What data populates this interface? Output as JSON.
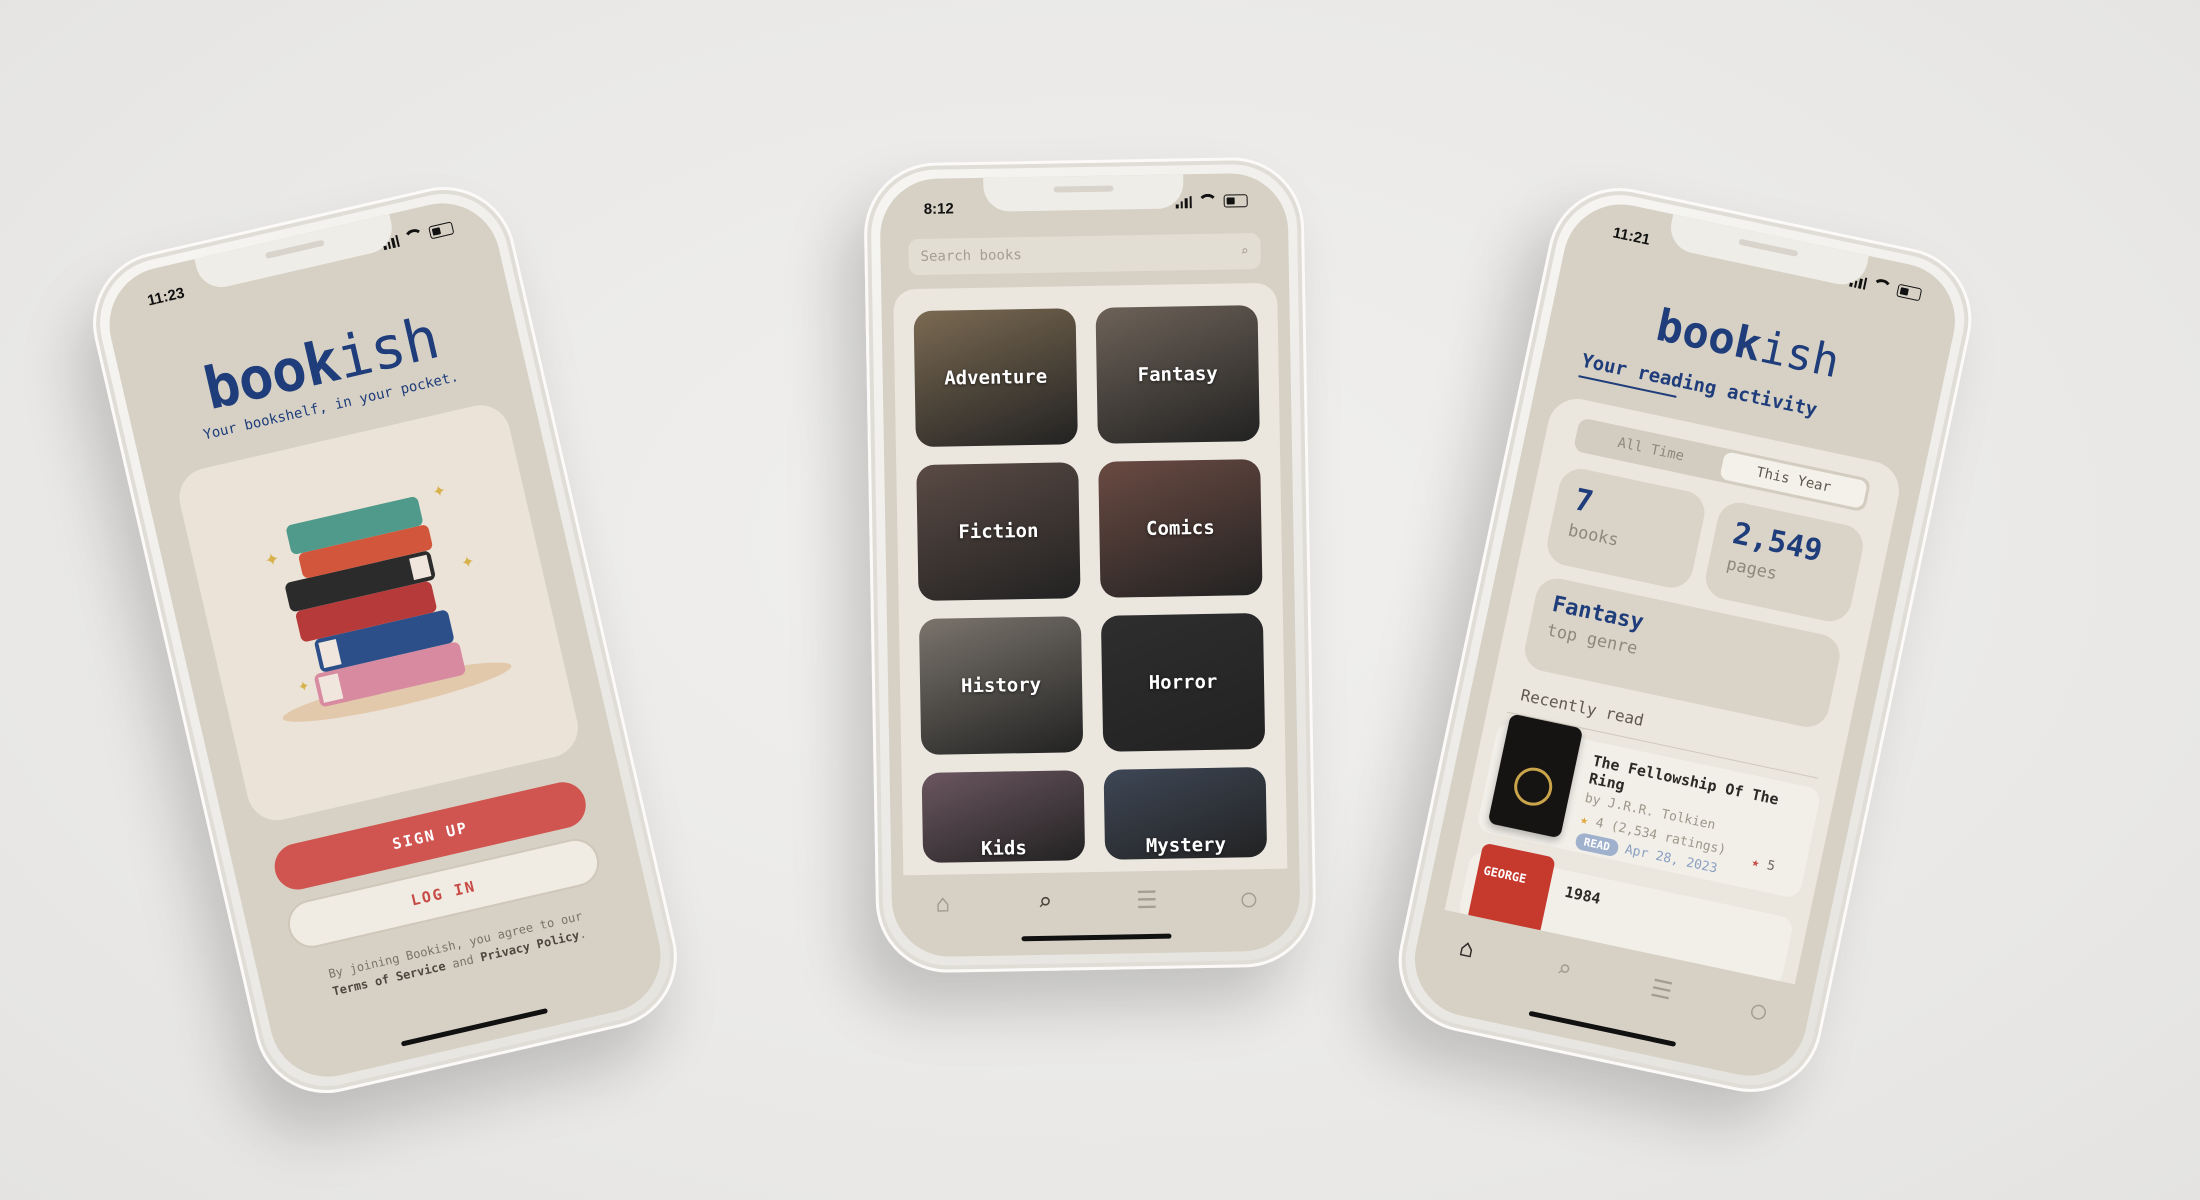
{
  "phone1": {
    "status_time": "11:23",
    "brand_bold": "book",
    "brand_light": "ish",
    "tagline": "Your bookshelf, in your pocket.",
    "signup_label": "SIGN UP",
    "login_label": "LOG IN",
    "legal_prefix": "By joining Bookish, you agree to our",
    "legal_terms": "Terms of Service",
    "legal_and": "and",
    "legal_privacy": "Privacy Policy",
    "legal_end": "."
  },
  "phone2": {
    "status_time": "8:12",
    "search_placeholder": "Search books",
    "genres": [
      {
        "label": "Adventure",
        "color": "#7b6a52"
      },
      {
        "label": "Fantasy",
        "color": "#6d6258"
      },
      {
        "label": "Fiction",
        "color": "#5a4a44"
      },
      {
        "label": "Comics",
        "color": "#6a4a42"
      },
      {
        "label": "History",
        "color": "#7a746c"
      },
      {
        "label": "Horror",
        "color": "#2e2e2e"
      },
      {
        "label": "Kids",
        "color": "#6b5660"
      },
      {
        "label": "Mystery",
        "color": "#3e4756"
      }
    ],
    "tabs": [
      "home-icon",
      "search-icon",
      "books-icon",
      "profile-icon"
    ]
  },
  "phone3": {
    "status_time": "11:21",
    "brand_bold": "book",
    "brand_light": "ish",
    "activity_title": "Your reading activity",
    "seg_all": "All Time",
    "seg_year": "This Year",
    "books_count": "7",
    "books_label": "books",
    "pages_count": "2,549",
    "pages_label": "pages",
    "genre_value": "Fantasy",
    "genre_label": "top genre",
    "recently_read": "Recently read",
    "book1": {
      "title": "The Fellowship Of The Ring",
      "author": "by J.R.R. Tolkien",
      "rating": "4",
      "ratings_count": "(2,534 ratings)",
      "status": "READ",
      "date": "Apr 28, 2023",
      "my_rating": "5"
    },
    "book2": {
      "title": "1984",
      "cover_text": "GEORGE"
    }
  },
  "colors": {
    "brand_blue": "#1f3d7a",
    "accent_red": "#d05450",
    "screen_bg": "#d7d1c5"
  }
}
